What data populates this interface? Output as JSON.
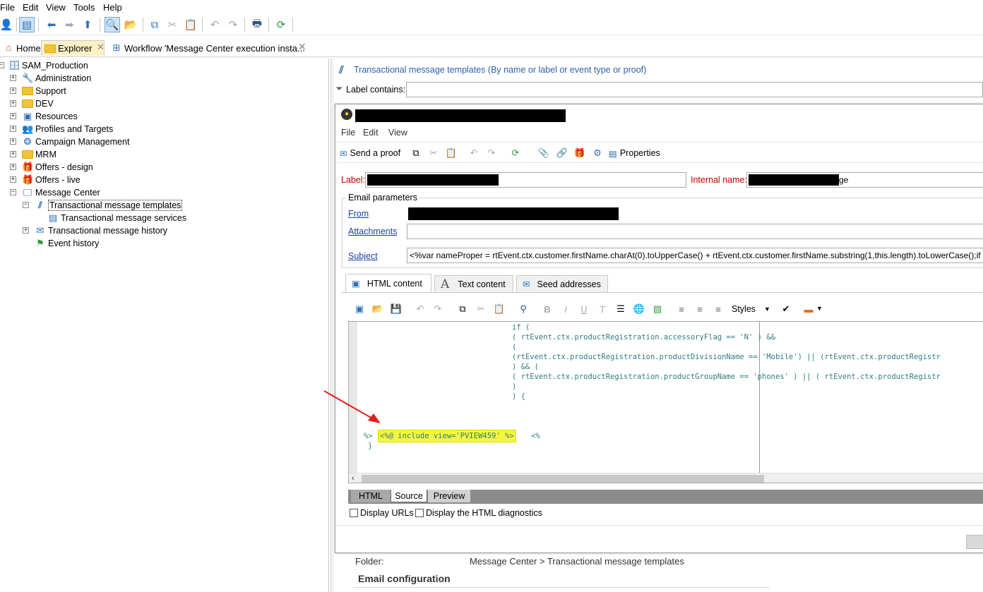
{
  "menu": {
    "file": "File",
    "edit": "Edit",
    "view": "View",
    "tools": "Tools",
    "help": "Help"
  },
  "tabs": {
    "home": "Home",
    "explorer": "Explorer",
    "workflow": "Workflow 'Message Center execution insta..."
  },
  "tree": {
    "root": "SAM_Production",
    "items": [
      {
        "label": "Administration"
      },
      {
        "label": "Support"
      },
      {
        "label": "DEV"
      },
      {
        "label": "Resources"
      },
      {
        "label": "Profiles and Targets"
      },
      {
        "label": "Campaign Management"
      },
      {
        "label": "MRM"
      },
      {
        "label": "Offers - design"
      },
      {
        "label": "Offers - live"
      },
      {
        "label": "Message Center"
      }
    ],
    "children": [
      {
        "label": "Transactional message templates"
      },
      {
        "label": "Transactional message services"
      },
      {
        "label": "Transactional message history"
      },
      {
        "label": "Event history"
      }
    ]
  },
  "right": {
    "title": "Transactional message templates (By name or label or event type or proof)",
    "filter_label": "Label contains:"
  },
  "editor": {
    "menu": {
      "file": "File",
      "edit": "Edit",
      "view": "View"
    },
    "toolbar": {
      "send_proof": "Send a proof",
      "properties": "Properties"
    },
    "label_label": "Label:",
    "internal_name_label": "Internal name:",
    "internal_name_tail": "ge",
    "email_params": "Email parameters",
    "from": "From",
    "attachments": "Attachments",
    "subject": "Subject",
    "subject_value": "<%var nameProper = rtEvent.ctx.customer.firstName.charAt(0).toUpperCase() + rtEvent.ctx.customer.firstName.substring(1,this.length).toLowerCase();if (r",
    "content_tabs": {
      "html": "HTML content",
      "text": "Text content",
      "seed": "Seed addresses"
    },
    "styles": "Styles",
    "code_lines": [
      "if (",
      "( rtEvent.ctx.productRegistration.accessoryFlag == 'N' ) &&",
      "(",
      "(rtEvent.ctx.productRegistration.productDivisionName == 'Mobile') || (rtEvent.ctx.productRegistr",
      ") && (",
      "( rtEvent.ctx.productRegistration.productGroupName == 'phones' ) || ( rtEvent.ctx.productRegistr",
      ")",
      ") {"
    ],
    "code_open": "%>",
    "code_include": "<%@ include view='PVIEW459' %>",
    "code_close": "<%",
    "code_brace": "}",
    "bottom_tabs": {
      "html": "HTML",
      "source": "Source",
      "preview": "Preview"
    },
    "display_urls": "Display URLs",
    "display_diag": "Display the HTML diagnostics"
  },
  "info": {
    "folder_label": "Folder:",
    "folder_value": "Message Center > Transactional message templates",
    "email_config": "Email configuration"
  },
  "colors": {
    "accent": "#2e6fb5",
    "highlight": "#f5f542",
    "arrow": "#e02020",
    "code": "#2f7d83"
  }
}
